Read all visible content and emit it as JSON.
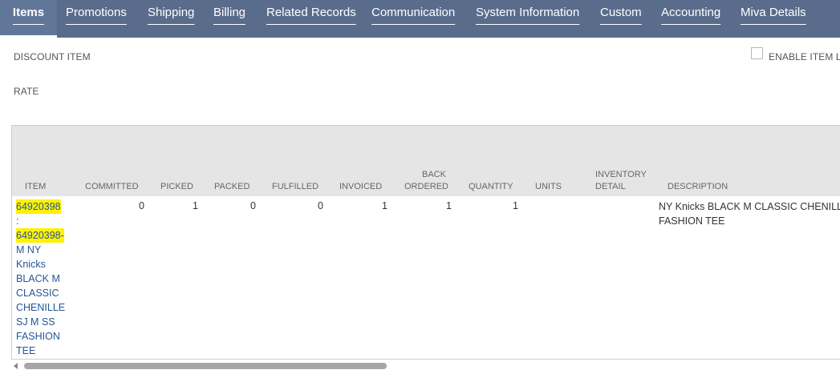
{
  "tabs": [
    {
      "label": "Items",
      "active": true
    },
    {
      "label": "Promotions"
    },
    {
      "label": "Shipping"
    },
    {
      "label": "Billing"
    },
    {
      "label": "Related Records"
    },
    {
      "label": "Communication"
    },
    {
      "label": "System Information"
    },
    {
      "label": "Custom"
    },
    {
      "label": "Accounting"
    },
    {
      "label": "Miva Details"
    }
  ],
  "fields": {
    "discount_item_label": "DISCOUNT ITEM",
    "rate_label": "RATE",
    "enable_item_label": "ENABLE ITEM LI"
  },
  "table": {
    "headers": {
      "item": "ITEM",
      "committed": "COMMITTED",
      "picked": "PICKED",
      "packed": "PACKED",
      "fulfilled": "FULFILLED",
      "invoiced": "INVOICED",
      "back_ordered_1": "BACK",
      "back_ordered_2": "ORDERED",
      "quantity": "QUANTITY",
      "units": "UNITS",
      "inventory_detail_1": "INVENTORY",
      "inventory_detail_2": "DETAIL",
      "description": "DESCRIPTION"
    },
    "row": {
      "item_lines": [
        "64920398",
        ":",
        "64920398-",
        "M NY",
        "Knicks",
        "BLACK M",
        "CLASSIC",
        "CHENILLE",
        "SJ M SS",
        "FASHION",
        "TEE"
      ],
      "committed": "0",
      "picked": "1",
      "packed": "0",
      "fulfilled": "0",
      "invoiced": "1",
      "back_ordered": "1",
      "quantity": "1",
      "description_lines": [
        "NY Knicks BLACK M CLASSIC CHENILLE SJ",
        "FASHION TEE"
      ]
    }
  },
  "colors": {
    "tabbar": "#5a6c8c",
    "link": "#255599",
    "highlight": "#fff200",
    "header_bg": "#e5e5e5"
  }
}
